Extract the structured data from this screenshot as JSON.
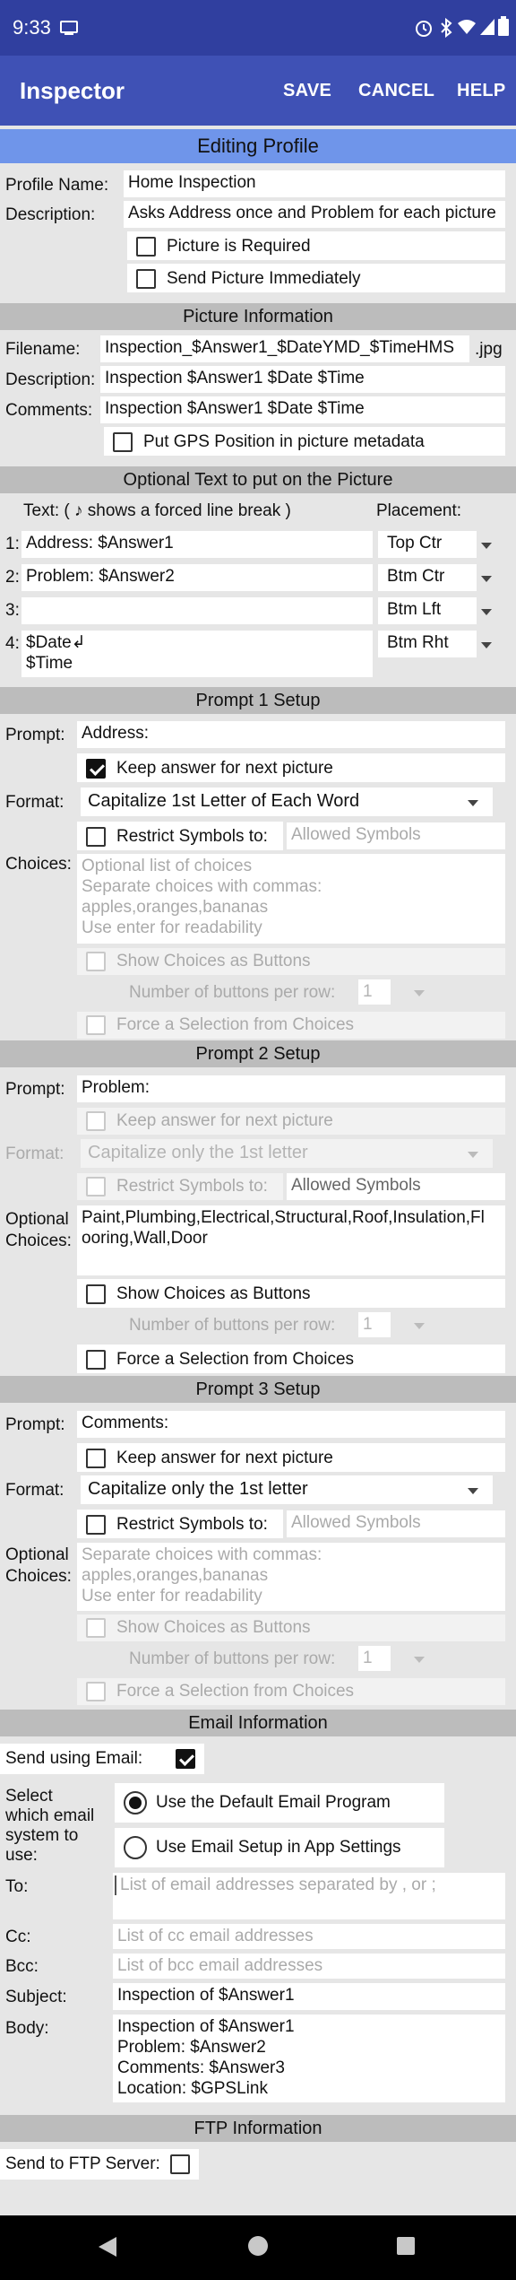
{
  "status_bar": {
    "time": "9:33",
    "icons": [
      "cast-icon",
      "alarm-icon",
      "bluetooth-icon",
      "wifi-icon",
      "signal-icon",
      "battery-icon"
    ]
  },
  "app_bar": {
    "title": "Inspector",
    "save": "SAVE",
    "cancel": "CANCEL",
    "help": "HELP"
  },
  "banner": "Editing Profile",
  "profile": {
    "name_label": "Profile Name:",
    "name_value": "Home Inspection",
    "desc_label": "Description:",
    "desc_value": "Asks Address once and Problem for each picture",
    "picture_required": "Picture is Required",
    "send_immediately": "Send Picture Immediately"
  },
  "picture_info": {
    "header": "Picture Information",
    "filename_label": "Filename:",
    "filename_value": "Inspection_$Answer1_$DateYMD_$TimeHMS",
    "ext": ".jpg",
    "desc_label": "Description:",
    "desc_value": "Inspection $Answer1 $Date $Time",
    "comments_label": "Comments:",
    "comments_value": "Inspection $Answer1 $Date $Time",
    "gps_label": "Put GPS Position in picture metadata"
  },
  "optional_text": {
    "header": "Optional Text to put on the Picture",
    "text_label": "Text: ( ♪ shows a forced line break )",
    "placement_label": "Placement:",
    "rows": [
      {
        "num": "1:",
        "text": "Address: $Answer1",
        "placement": "Top Ctr"
      },
      {
        "num": "2:",
        "text": "Problem: $Answer2",
        "placement": "Btm Ctr"
      },
      {
        "num": "3:",
        "text": "",
        "placement": "Btm Lft"
      },
      {
        "num": "4:",
        "text_line1": "$Date↲",
        "text_line2": "$Time",
        "placement": "Btm Rht"
      }
    ]
  },
  "prompt1": {
    "header": "Prompt 1 Setup",
    "prompt_label": "Prompt:",
    "prompt_value": "Address:",
    "keep_label": "Keep answer for next picture",
    "format_label": "Format:",
    "format_value": "Capitalize 1st Letter of Each Word",
    "restrict_label": "Restrict Symbols to:",
    "restrict_placeholder": "Allowed Symbols",
    "choices_label": "Choices:",
    "choices_placeholder_l1": "Optional list of choices",
    "choices_placeholder_l2": "Separate choices with commas:",
    "choices_placeholder_l3": "apples,oranges,bananas",
    "choices_placeholder_l4": "Use enter for readability",
    "show_buttons_label": "Show Choices as Buttons",
    "buttons_per_row_label": "Number of buttons per row:",
    "buttons_per_row_value": "1",
    "force_label": "Force a Selection from Choices"
  },
  "prompt2": {
    "header": "Prompt 2 Setup",
    "prompt_label": "Prompt:",
    "prompt_value": "Problem:",
    "keep_label": "Keep answer for next picture",
    "format_label": "Format:",
    "format_value": "Capitalize only the 1st letter",
    "restrict_label": "Restrict Symbols to:",
    "restrict_placeholder": "Allowed Symbols",
    "choices_label_l1": "Optional",
    "choices_label_l2": "Choices:",
    "choices_value_l1": "Paint,Plumbing,Electrical,Structural,Roof,Insulation,Fl",
    "choices_value_l2": "ooring,Wall,Door",
    "show_buttons_label": "Show Choices as Buttons",
    "buttons_per_row_label": "Number of buttons per row:",
    "buttons_per_row_value": "1",
    "force_label": "Force a Selection from Choices"
  },
  "prompt3": {
    "header": "Prompt 3 Setup",
    "prompt_label": "Prompt:",
    "prompt_value": "Comments:",
    "keep_label": "Keep answer for next picture",
    "format_label": "Format:",
    "format_value": "Capitalize only the 1st letter",
    "restrict_label": "Restrict Symbols to:",
    "restrict_placeholder": "Allowed Symbols",
    "choices_label_l1": "Optional",
    "choices_label_l2": "Choices:",
    "choices_placeholder_l1": "Separate choices with commas:",
    "choices_placeholder_l2": "apples,oranges,bananas",
    "choices_placeholder_l3": "Use enter for readability",
    "show_buttons_label": "Show Choices as Buttons",
    "buttons_per_row_label": "Number of buttons per row:",
    "buttons_per_row_value": "1",
    "force_label": "Force a Selection from Choices"
  },
  "email": {
    "header": "Email Information",
    "send_label": "Send using Email:",
    "select_label_l1": "Select",
    "select_label_l2": "which email",
    "select_label_l3": "system to",
    "select_label_l4": "use:",
    "option_default": "Use the Default Email Program",
    "option_app": "Use Email Setup in App Settings",
    "to_label": "To:",
    "to_placeholder": "List of email addresses separated by , or ;",
    "cc_label": "Cc:",
    "cc_placeholder": "List of cc email addresses",
    "bcc_label": "Bcc:",
    "bcc_placeholder": "List of bcc email addresses",
    "subject_label": "Subject:",
    "subject_value": "Inspection of $Answer1",
    "body_label": "Body:",
    "body_l1": "Inspection of $Answer1",
    "body_l2": "Problem: $Answer2",
    "body_l3": "Comments: $Answer3",
    "body_l4": "Location: $GPSLink"
  },
  "ftp": {
    "header": "FTP Information",
    "send_label": "Send to FTP Server:"
  },
  "nav": {
    "icons": [
      "back-icon",
      "home-icon",
      "recents-icon"
    ]
  },
  "colors": {
    "status_bar": "#303f9f",
    "app_bar": "#3f51b5",
    "banner": "#6f95ea",
    "section": "#bcbcbc",
    "background": "#e6e6e6"
  }
}
